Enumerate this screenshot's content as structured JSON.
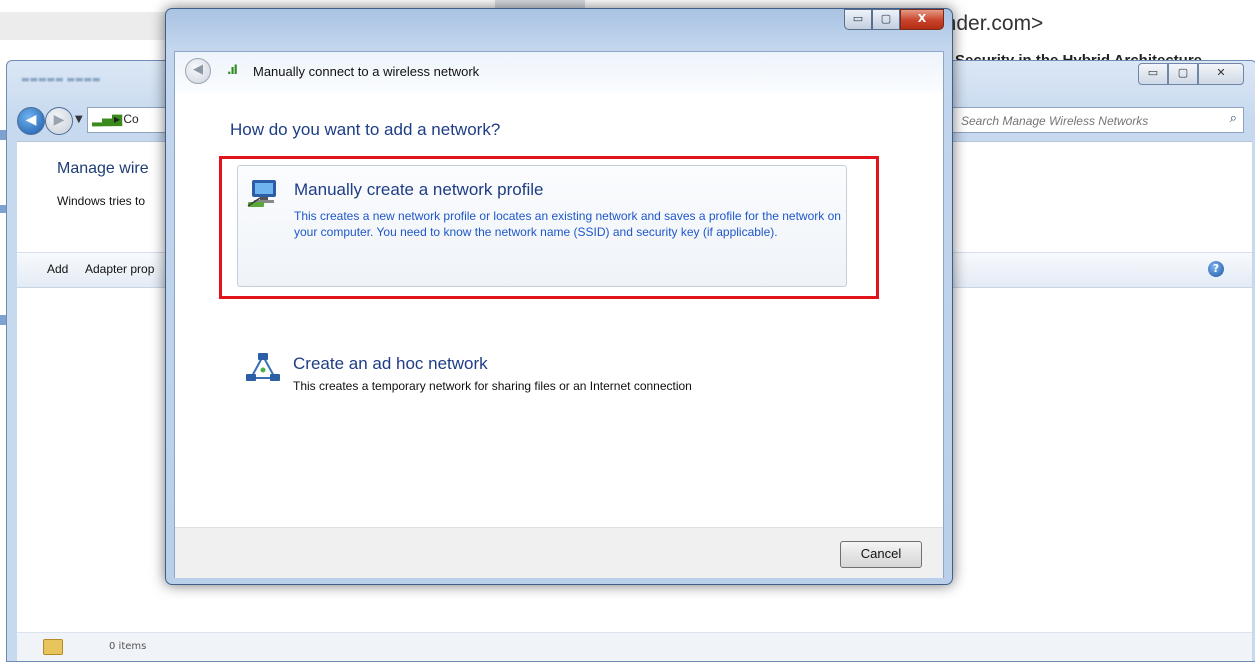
{
  "background_email": {
    "sender_domain": "ender.com>",
    "subject": "Security in the Hybrid Architecture"
  },
  "background_window": {
    "nav": {
      "breadcrumb": "Co"
    },
    "search": {
      "placeholder": "Search Manage Wireless Networks"
    },
    "page_title": "Manage wire",
    "page_desc": "Windows tries to",
    "toolbar": {
      "add_label": "Add",
      "adapter_label": "Adapter prop"
    },
    "status_text": "0 items"
  },
  "dialog": {
    "title": "Manually connect to a wireless network",
    "question": "How do you want to add a network?",
    "options": [
      {
        "title": "Manually create a network profile",
        "description": "This creates a new network profile or locates an existing network and saves a profile for the network on your computer. You need to know the network name (SSID) and security key (if applicable)."
      },
      {
        "title": "Create an ad hoc network",
        "description": "This creates a temporary network for sharing files or an Internet connection"
      }
    ],
    "cancel_label": "Cancel"
  },
  "colors": {
    "highlight": "#e0141a",
    "link_blue": "#1e3d86",
    "desc_blue": "#1e57c8"
  }
}
